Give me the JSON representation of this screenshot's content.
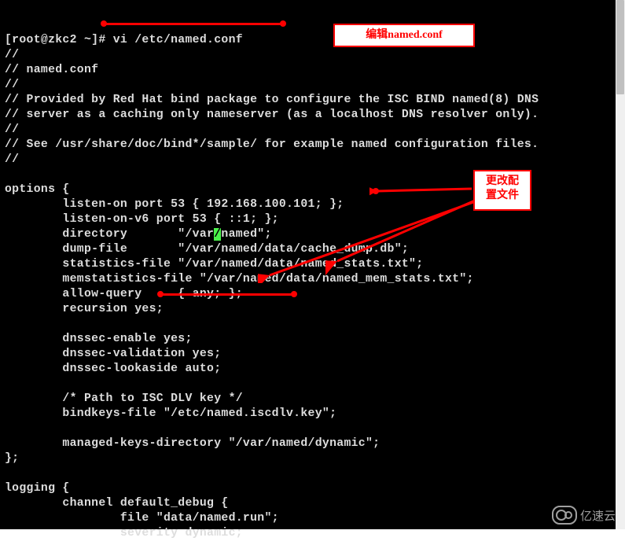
{
  "terminal": {
    "lines": [
      "[root@zkc2 ~]# vi /etc/named.conf",
      "//",
      "// named.conf",
      "//",
      "// Provided by Red Hat bind package to configure the ISC BIND named(8) DNS",
      "// server as a caching only nameserver (as a localhost DNS resolver only).",
      "//",
      "// See /usr/share/doc/bind*/sample/ for example named configuration files.",
      "//",
      "",
      "options {",
      "        listen-on port 53 { 192.168.100.101; };",
      "        listen-on-v6 port 53 { ::1; };",
      "        directory       \"/var/named\";",
      "        dump-file       \"/var/named/data/cache_dump.db\";",
      "        statistics-file \"/var/named/data/named_stats.txt\";",
      "        memstatistics-file \"/var/named/data/named_mem_stats.txt\";",
      "        allow-query     { any; };",
      "        recursion yes;",
      "",
      "        dnssec-enable yes;",
      "        dnssec-validation yes;",
      "        dnssec-lookaside auto;",
      "",
      "        /* Path to ISC DLV key */",
      "        bindkeys-file \"/etc/named.iscdlv.key\";",
      "",
      "        managed-keys-directory \"/var/named/dynamic\";",
      "};",
      "",
      "logging {",
      "        channel default_debug {",
      "                file \"data/named.run\";",
      "                severity dynamic;"
    ],
    "cursor_line_index": 13,
    "cursor_line_pre": "        directory       \"/var",
    "cursor_char": "/",
    "cursor_line_post": "named\";"
  },
  "callouts": {
    "edit_named_conf": "编辑named.conf",
    "change_config": "更改配\n置文件"
  },
  "watermark": "亿速云"
}
